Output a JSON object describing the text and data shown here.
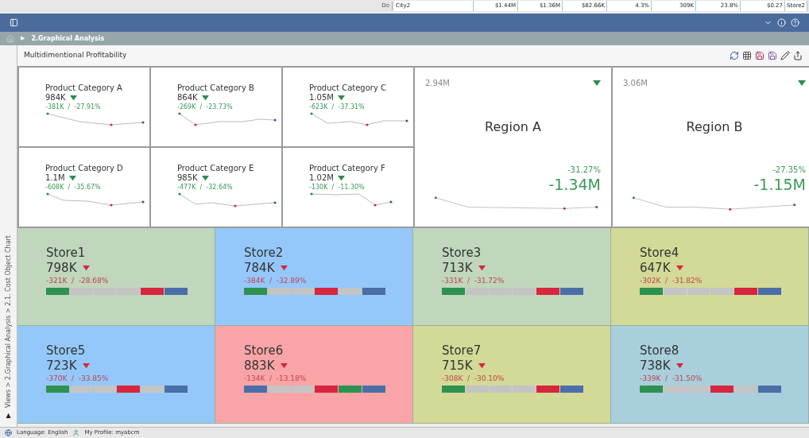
{
  "background_row": {
    "label": "Do",
    "cells": [
      "City2",
      "$1.44M",
      "$1.36M",
      "$82.66K",
      "4.3%",
      "309K",
      "23.8%",
      "$0.27",
      "Store2"
    ]
  },
  "breadcrumb": {
    "arrow": "▶",
    "label": "2.Graphical Analysis"
  },
  "panel": {
    "title": "Multidimentional Profitability"
  },
  "side_path": {
    "arrow": "▲",
    "text": "Views > 2.Graphical Analysis > 2.1. Cost Object Chart"
  },
  "categories": [
    {
      "name": "Product Category A",
      "value": "984K",
      "decreased": true,
      "delta": "-381K  /  -27.91%"
    },
    {
      "name": "Product Category B",
      "value": "864K",
      "decreased": true,
      "delta": "-269K  /  -23.73%"
    },
    {
      "name": "Product Category C",
      "value": "1.05M",
      "decreased": true,
      "delta": "-623K  /  -37.31%"
    },
    {
      "name": "Product Category D",
      "value": "1.1M",
      "decreased": true,
      "delta": "-608K  /  -35.67%"
    },
    {
      "name": "Product Category E",
      "value": "985K",
      "decreased": true,
      "delta": "-477K  /  -32.64%"
    },
    {
      "name": "Product Category F",
      "value": "1.02M",
      "decreased": true,
      "delta": "-130K  /  -11.30%"
    }
  ],
  "regions": [
    {
      "name": "Region A",
      "total": "2.94M",
      "decreased": true,
      "percent": "-31.27%",
      "change": "-1.34M"
    },
    {
      "name": "Region B",
      "total": "3.06M",
      "decreased": true,
      "percent": "-27.35%",
      "change": "-1.15M"
    }
  ],
  "stores": [
    {
      "name": "Store1",
      "value": "798K",
      "decreased": true,
      "delta": "-321K  /  -28.68%",
      "color": "#c0d6bd",
      "segments": [
        {
          "color": "#2e9150"
        },
        {
          "color": "#c4c4c4"
        },
        {
          "color": "#c4c4c4"
        },
        {
          "color": "#c4c4c4"
        },
        {
          "color": "#d7263d"
        },
        {
          "color": "#4a6ea8"
        }
      ]
    },
    {
      "name": "Store2",
      "value": "784K",
      "decreased": true,
      "delta": "-384K  /  -32.89%",
      "color": "#94c8fa",
      "segments": [
        {
          "color": "#2e9150"
        },
        {
          "color": "#c4c4c4"
        },
        {
          "color": "#c4c4c4"
        },
        {
          "color": "#d7263d"
        },
        {
          "color": "#c4c4c4"
        },
        {
          "color": "#4a6ea8"
        }
      ]
    },
    {
      "name": "Store3",
      "value": "713K",
      "decreased": true,
      "delta": "-331K  /  -31.72%",
      "color": "#c0d6bd",
      "segments": [
        {
          "color": "#2e9150"
        },
        {
          "color": "#c4c4c4"
        },
        {
          "color": "#c4c4c4"
        },
        {
          "color": "#c4c4c4"
        },
        {
          "color": "#d7263d"
        },
        {
          "color": "#4a6ea8"
        }
      ]
    },
    {
      "name": "Store4",
      "value": "647K",
      "decreased": true,
      "delta": "-302K  /  -31.82%",
      "color": "#d3d996",
      "segments": [
        {
          "color": "#2e9150"
        },
        {
          "color": "#c4c4c4"
        },
        {
          "color": "#c4c4c4"
        },
        {
          "color": "#c4c4c4"
        },
        {
          "color": "#d7263d"
        },
        {
          "color": "#4a6ea8"
        }
      ]
    },
    {
      "name": "Store5",
      "value": "723K",
      "decreased": true,
      "delta": "-370K  /  -33.85%",
      "color": "#94c8fa",
      "segments": [
        {
          "color": "#2e9150"
        },
        {
          "color": "#c4c4c4"
        },
        {
          "color": "#c4c4c4"
        },
        {
          "color": "#d7263d"
        },
        {
          "color": "#c4c4c4"
        },
        {
          "color": "#4a6ea8"
        }
      ]
    },
    {
      "name": "Store6",
      "value": "883K",
      "decreased": true,
      "delta": "-134K  /  -13.18%",
      "color": "#f9a5a8",
      "segments": [
        {
          "color": "#4a6ea8"
        },
        {
          "color": "#c4c4c4"
        },
        {
          "color": "#c4c4c4"
        },
        {
          "color": "#d7263d"
        },
        {
          "color": "#2e9150"
        },
        {
          "color": "#4a6ea8"
        }
      ]
    },
    {
      "name": "Store7",
      "value": "715K",
      "decreased": true,
      "delta": "-308K  /  -30.10%",
      "color": "#d3d996",
      "segments": [
        {
          "color": "#2e9150"
        },
        {
          "color": "#c4c4c4"
        },
        {
          "color": "#c4c4c4"
        },
        {
          "color": "#c4c4c4"
        },
        {
          "color": "#d7263d"
        },
        {
          "color": "#4a6ea8"
        }
      ]
    },
    {
      "name": "Store8",
      "value": "738K",
      "decreased": true,
      "delta": "-339K  /  -31.50%",
      "color": "#a9cfdc",
      "segments": [
        {
          "color": "#2e9150"
        },
        {
          "color": "#c4c4c4"
        },
        {
          "color": "#c4c4c4"
        },
        {
          "color": "#d7263d"
        },
        {
          "color": "#c4c4c4"
        },
        {
          "color": "#4a6ea8"
        }
      ]
    }
  ],
  "status_bar": {
    "language": "Language: English",
    "profile": "My Profile: myabcm"
  }
}
